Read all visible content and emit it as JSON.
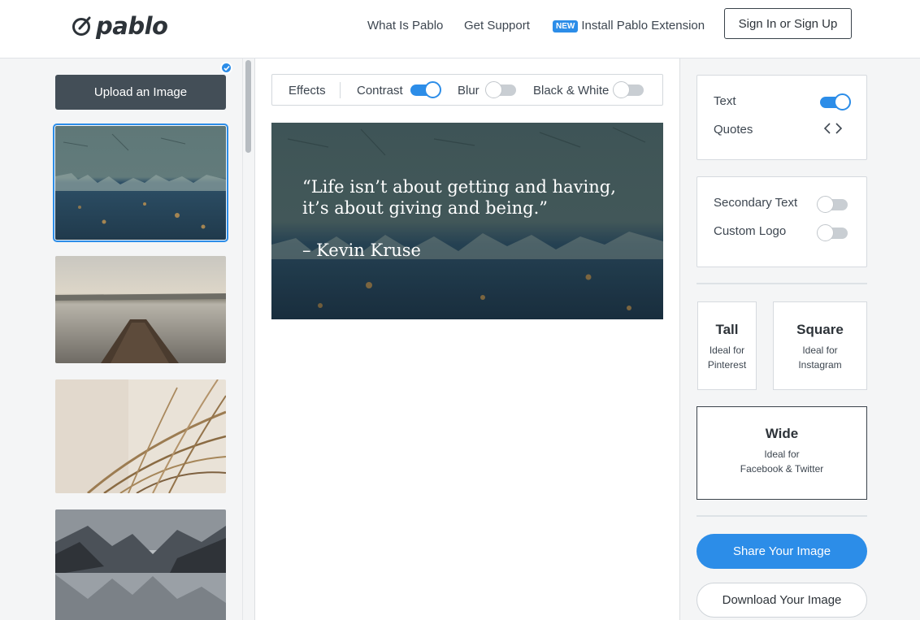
{
  "header": {
    "logo_text": "pablo",
    "nav": {
      "what_is": "What Is Pablo",
      "support": "Get Support",
      "new_badge": "NEW",
      "extension": "Install Pablo Extension"
    },
    "signin_label": "Sign In or Sign Up"
  },
  "sidebar": {
    "upload_label": "Upload an Image",
    "selected_index": 0
  },
  "effects": {
    "label": "Effects",
    "contrast": {
      "label": "Contrast",
      "on": true
    },
    "blur": {
      "label": "Blur",
      "on": false
    },
    "bw": {
      "label": "Black & White",
      "on": false
    }
  },
  "canvas": {
    "quote": "“Life isn’t about getting and having, it’s about giving and being.”",
    "author": "– Kevin Kruse"
  },
  "options": {
    "text": {
      "label": "Text",
      "on": true
    },
    "quotes": {
      "label": "Quotes"
    },
    "secondary_text": {
      "label": "Secondary Text",
      "on": false
    },
    "custom_logo": {
      "label": "Custom Logo",
      "on": false
    }
  },
  "sizes": {
    "tall": {
      "title": "Tall",
      "sub1": "Ideal for",
      "sub2": "Pinterest"
    },
    "square": {
      "title": "Square",
      "sub1": "Ideal for",
      "sub2": "Instagram"
    },
    "wide": {
      "title": "Wide",
      "sub1": "Ideal for",
      "sub2": "Facebook & Twitter",
      "selected": true
    }
  },
  "actions": {
    "share_label": "Share Your Image",
    "download_label": "Download Your Image"
  },
  "colors": {
    "accent": "#2c8de8",
    "dark_button": "#434e57"
  }
}
